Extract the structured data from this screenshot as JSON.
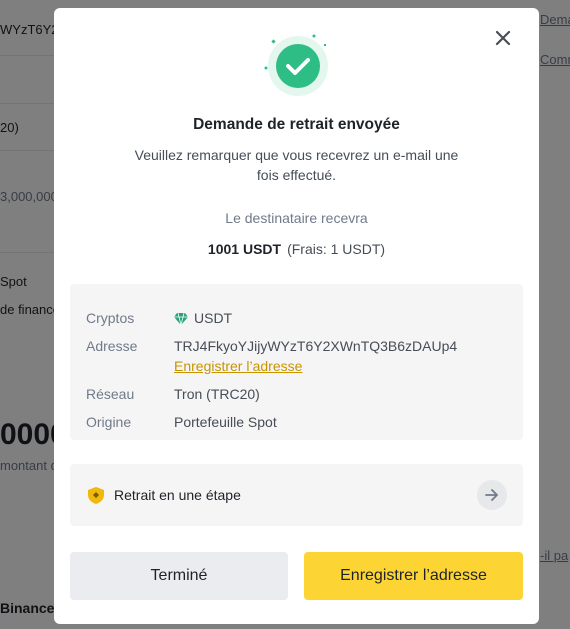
{
  "background": {
    "texts": [
      "WYzT6Y2",
      "20)",
      "3,000,000",
      "Spot",
      "de finance",
      "0000",
      "montant d",
      "Binance"
    ],
    "links": [
      "Dema",
      "Comm",
      "-il pa"
    ]
  },
  "modal": {
    "title": "Demande de retrait envoyée",
    "subtitle": "Veuillez remarquer que vous recevrez un e-mail une fois effectué.",
    "recipient_label": "Le destinataire recevra",
    "amount": "1001 USDT",
    "fee": "(Frais: 1 USDT)",
    "details": {
      "crypto_label": "Cryptos",
      "crypto_value": "USDT",
      "address_label": "Adresse",
      "address_value": "TRJ4FkyoYJijyWYzT6Y2XWnTQ3B6zDAUp4",
      "save_address_link": "Enregistrer l’adresse",
      "network_label": "Réseau",
      "network_value": "Tron (TRC20)",
      "origin_label": "Origine",
      "origin_value": "Portefeuille Spot"
    },
    "one_step_label": "Retrait en une étape",
    "done_button": "Terminé",
    "save_button": "Enregistrer l’adresse"
  },
  "colors": {
    "accent": "#fcd535",
    "success": "#2ebd85",
    "link": "#c99400"
  },
  "icons": [
    "close-icon",
    "success-check-icon",
    "usdt-gem-icon",
    "shield-icon",
    "arrow-right-icon"
  ]
}
